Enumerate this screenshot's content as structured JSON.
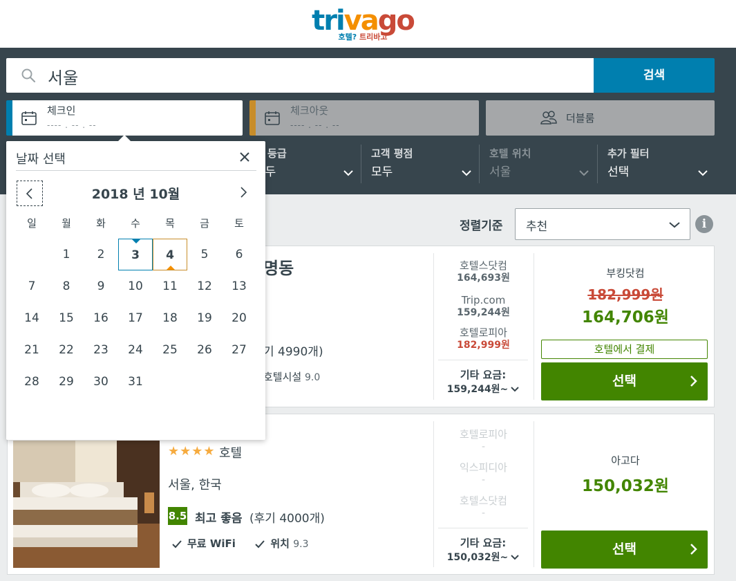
{
  "header": {
    "logo_parts": [
      "tri",
      "va",
      "go"
    ],
    "tagline_a": "호텔? ",
    "tagline_b": "트리바고",
    "colors": {
      "blue": "#007faf",
      "orange": "#f48f00",
      "red": "#c94a38"
    }
  },
  "search": {
    "icon": "search-icon",
    "value": "서울",
    "button_label": "검색"
  },
  "dates": {
    "checkin_label": "체크인",
    "checkin_placeholder": "---- . -- . --",
    "checkout_label": "체크아웃",
    "checkout_placeholder": "---- . -- . --",
    "room_label": "더블룸",
    "room_icon": "people-icon"
  },
  "filters": [
    {
      "title": "텔 등급",
      "value": "모두"
    },
    {
      "title": "고객 평점",
      "value": "모두"
    },
    {
      "title": "호텔 위치",
      "value": "서울"
    },
    {
      "title": "추가 필터",
      "value": "선택"
    }
  ],
  "sort": {
    "label": "정렬기준",
    "value": "추천",
    "info_icon": "i"
  },
  "datepicker": {
    "title": "날짜 선택",
    "month_label": "2018 년 10월",
    "weekdays": [
      "일",
      "월",
      "화",
      "수",
      "목",
      "금",
      "토"
    ],
    "days": [
      "1",
      "2",
      "3",
      "4",
      "5",
      "6",
      "7",
      "8",
      "9",
      "10",
      "11",
      "12",
      "13",
      "14",
      "15",
      "16",
      "17",
      "18",
      "19",
      "20",
      "21",
      "22",
      "23",
      "24",
      "25",
      "26",
      "27",
      "28",
      "29",
      "30",
      "31"
    ],
    "checkin_day": "3",
    "checkout_day": "4"
  },
  "card1": {
    "name_partial": "명동",
    "review_partial": "기 4990개)",
    "amenity_partial": "호텔시설",
    "amenity_score": "9.0",
    "otas": [
      {
        "name": "호텔스닷컴",
        "price": "164,693원"
      },
      {
        "name": "Trip.com",
        "price": "159,244원"
      },
      {
        "name": "호텔로피아",
        "price": "182,999원"
      }
    ],
    "other_label": "기타 요금:",
    "other_price": "159,244원~",
    "deal_site": "부킹닷컴",
    "old_price": "182,999원",
    "deal_price": "164,706원",
    "pay_label": "호텔에서 결제",
    "select_label": "선택"
  },
  "card2": {
    "stars": "★★★★",
    "type": "호텔",
    "location": "서울, 한국",
    "rating": "8.5",
    "rating_label": "최고 좋음",
    "rating_count": "(후기 4000개)",
    "amenity1": "무료 WiFi",
    "amenity2": "위치",
    "amenity2_score": "9.3",
    "otas": [
      {
        "name": "호텔로피아",
        "price": "-"
      },
      {
        "name": "익스피디아",
        "price": "-"
      },
      {
        "name": "호텔스닷컴",
        "price": "-"
      }
    ],
    "other_label": "기타 요금:",
    "other_price": "150,032원~",
    "deal_site": "아고다",
    "deal_price": "150,032원",
    "select_label": "선택"
  }
}
